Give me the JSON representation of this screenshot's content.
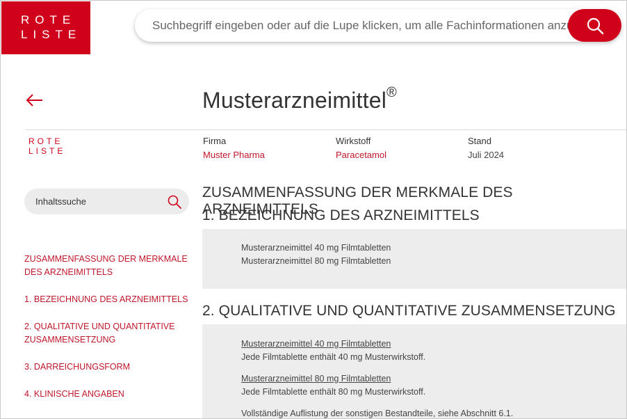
{
  "brand": {
    "logo_line1": "ROTE",
    "logo_line2": "LISTE",
    "accent_color": "#d0021b"
  },
  "search": {
    "placeholder": "Suchbegriff eingeben oder auf die Lupe klicken, um alle Fachinformationen anzuzeigen",
    "button_icon": "search-icon"
  },
  "header": {
    "back_icon": "arrow-left-icon",
    "title": "Musterarzneimittel",
    "title_mark": "®"
  },
  "meta": {
    "firma_label": "Firma",
    "firma_value": "Muster Pharma",
    "wirkstoff_label": "Wirkstoff",
    "wirkstoff_value": "Paracetamol",
    "stand_label": "Stand",
    "stand_value": "Juli 2024"
  },
  "sidebar": {
    "content_search_placeholder": "Inhaltssuche",
    "toc": [
      "ZUSAMMENFASSUNG DER MERKMALE DES ARZNEIMITTELS",
      "1. BEZEICHNUNG DES ARZNEIMITTELS",
      "2. QUALITATIVE UND QUANTITATIVE ZUSAMMENSETZUNG",
      "3. DARREICHUNGSFORM",
      "4. KLINISCHE ANGABEN"
    ]
  },
  "main": {
    "heading": "ZUSAMMENFASSUNG DER MERKMALE DES ARZNEIMITTELS",
    "section1": {
      "heading": "1. BEZEICHNUNG DES ARZNEIMITTELS",
      "lines": [
        "Musterarzneimittel 40 mg Filmtabletten",
        "Musterarzneimittel 80 mg Filmtabletten"
      ]
    },
    "section2": {
      "heading": "2. QUALITATIVE UND QUANTITATIVE ZUSAMMENSETZUNG",
      "item1_title": "Musterarzneimittel 40 mg Filmtabletten",
      "item1_text": "Jede Filmtablette enthält 40 mg Musterwirkstoff.",
      "item2_title": "Musterarzneimittel 80 mg Filmtabletten",
      "item2_text": "Jede Filmtablette enthält 80 mg Musterwirkstoff.",
      "note": "Vollständige Auflistung der sonstigen Bestandteile, siehe Abschnitt 6.1."
    }
  }
}
